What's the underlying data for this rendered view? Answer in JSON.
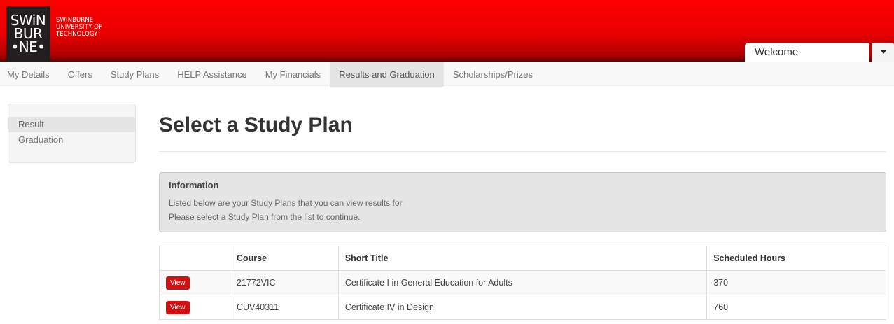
{
  "brand": {
    "logo_lines": [
      "SWiN",
      "BUR",
      "•NE•"
    ],
    "name_lines": [
      "SWINBURNE",
      "UNIVERSITY OF",
      "TECHNOLOGY"
    ]
  },
  "user_menu": {
    "welcome": "Welcome"
  },
  "nav": {
    "items": [
      {
        "label": "My Details"
      },
      {
        "label": "Offers"
      },
      {
        "label": "Study Plans"
      },
      {
        "label": "HELP Assistance"
      },
      {
        "label": "My Financials"
      },
      {
        "label": "Results and Graduation",
        "active": true
      },
      {
        "label": "Scholarships/Prizes"
      }
    ]
  },
  "sidebar": {
    "items": [
      {
        "label": "Result",
        "active": true
      },
      {
        "label": "Graduation"
      }
    ]
  },
  "page": {
    "title": "Select a Study Plan"
  },
  "info": {
    "heading": "Information",
    "lines": [
      "Listed below are your Study Plans that you can view results for.",
      "Please select a Study Plan from the list to continue."
    ]
  },
  "table": {
    "headers": [
      "",
      "Course",
      "Short Title",
      "Scheduled Hours"
    ],
    "rows": [
      {
        "action": "View",
        "course": "21772VIC",
        "title": "Certificate I in General Education for Adults",
        "hours": "370"
      },
      {
        "action": "View",
        "course": "CUV40311",
        "title": "Certificate IV in Design",
        "hours": "760"
      }
    ]
  },
  "colors": {
    "header_red": "#ff0000",
    "button_red": "#d11010"
  }
}
